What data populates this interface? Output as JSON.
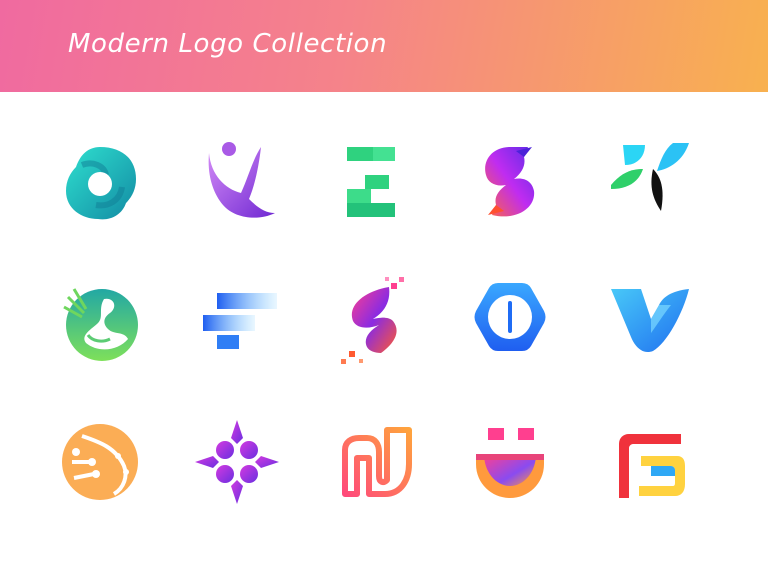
{
  "header": {
    "title": "Modern Logo Collection",
    "gradient": [
      "#f06aa0",
      "#f5838a",
      "#f8b14f"
    ]
  },
  "logos": [
    {
      "icon": "teal-blossom-ring-icon",
      "colors": [
        "#1fd1c4",
        "#1591a6"
      ]
    },
    {
      "icon": "purple-figure-swoosh-icon",
      "colors": [
        "#c06bf2",
        "#7b2fd6"
      ]
    },
    {
      "icon": "green-block-letter-e-icon",
      "colors": [
        "#3ddc8a",
        "#23c27a"
      ]
    },
    {
      "icon": "gradient-letter-s-icon",
      "colors": [
        "#ff6a3d",
        "#c02cf0",
        "#5b2be8"
      ]
    },
    {
      "icon": "leaf-letter-k-icon",
      "colors": [
        "#2bd5f5",
        "#2fd06a",
        "#111111"
      ]
    },
    {
      "icon": "green-swan-circle-icon",
      "colors": [
        "#27b3a0",
        "#7ee05a"
      ]
    },
    {
      "icon": "blue-speed-letter-f-icon",
      "colors": [
        "#3aa0ff",
        "#1f5ef0"
      ]
    },
    {
      "icon": "pixel-dna-letter-s-icon",
      "colors": [
        "#ff3f8f",
        "#8a2be2",
        "#ff5a30"
      ]
    },
    {
      "icon": "blue-hexagon-power-icon",
      "colors": [
        "#3aa8ff",
        "#1f6cf5"
      ]
    },
    {
      "icon": "blue-wing-letter-v-icon",
      "colors": [
        "#3fb8f5",
        "#2f7ff0"
      ]
    },
    {
      "icon": "orange-molecule-circle-icon",
      "colors": [
        "#ffb25a",
        "#f59a45"
      ]
    },
    {
      "icon": "purple-sparkle-cluster-icon",
      "colors": [
        "#c43ae0",
        "#7b2fe0"
      ]
    },
    {
      "icon": "gradient-outline-letter-m-icon",
      "colors": [
        "#ff5a6a",
        "#ff9a3d"
      ]
    },
    {
      "icon": "smile-letter-u-icon",
      "colors": [
        "#ff3f8f",
        "#8a4bf0",
        "#ff9a3d"
      ]
    },
    {
      "icon": "red-yellow-blue-letter-g-icon",
      "colors": [
        "#f0323c",
        "#ffd23f",
        "#2fa8f5"
      ]
    }
  ]
}
